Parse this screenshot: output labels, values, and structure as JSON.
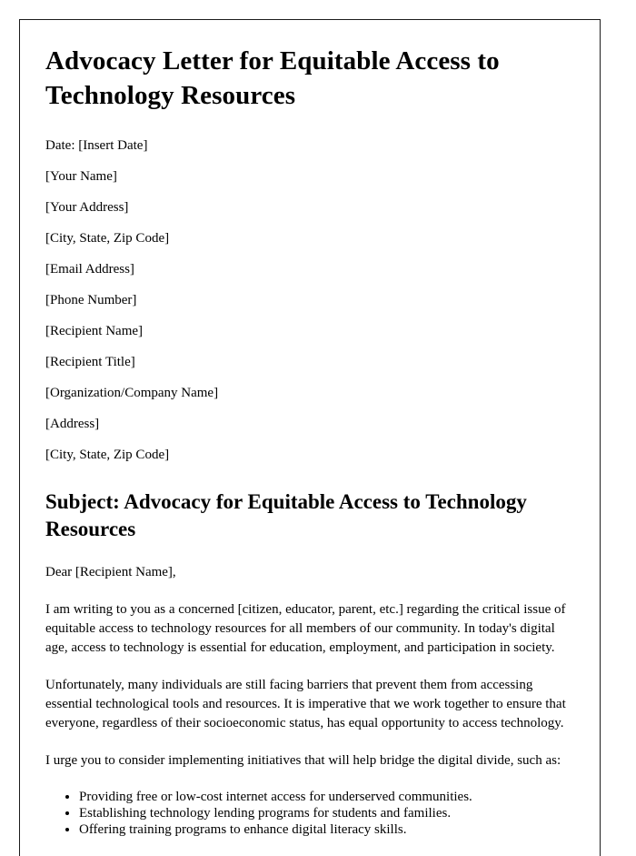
{
  "document": {
    "title": "Advocacy Letter for Equitable Access to Technology Resources",
    "sender_block": [
      "Date: [Insert Date]",
      "[Your Name]",
      "[Your Address]",
      "[City, State, Zip Code]",
      "[Email Address]",
      "[Phone Number]"
    ],
    "recipient_block": [
      "[Recipient Name]",
      "[Recipient Title]",
      "[Organization/Company Name]",
      "[Address]",
      "[City, State, Zip Code]"
    ],
    "subject_heading": "Subject: Advocacy for Equitable Access to Technology Resources",
    "salutation": "Dear [Recipient Name],",
    "paragraphs": [
      "I am writing to you as a concerned [citizen, educator, parent, etc.] regarding the critical issue of equitable access to technology resources for all members of our community. In today's digital age, access to technology is essential for education, employment, and participation in society.",
      "Unfortunately, many individuals are still facing barriers that prevent them from accessing essential technological tools and resources. It is imperative that we work together to ensure that everyone, regardless of their socioeconomic status, has equal opportunity to access technology.",
      "I urge you to consider implementing initiatives that will help bridge the digital divide, such as:"
    ],
    "bullets": [
      "Providing free or low-cost internet access for underserved communities.",
      "Establishing technology lending programs for students and families.",
      "Offering training programs to enhance digital literacy skills."
    ]
  }
}
